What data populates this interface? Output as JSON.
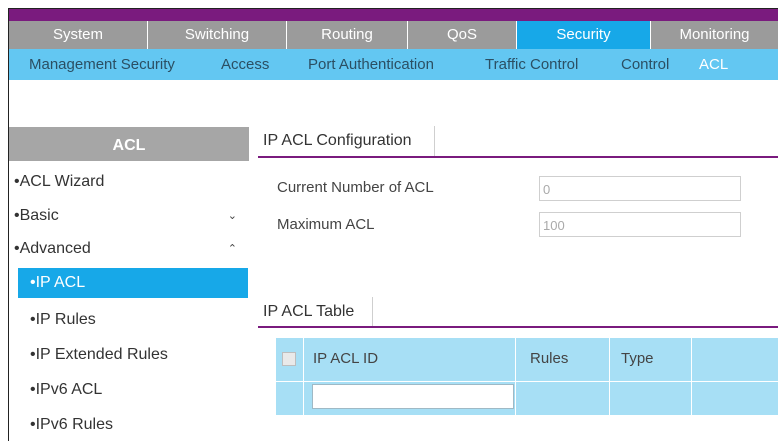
{
  "topnav": {
    "tabs": [
      {
        "label": "System"
      },
      {
        "label": "Switching"
      },
      {
        "label": "Routing"
      },
      {
        "label": "QoS"
      },
      {
        "label": "Security",
        "active": true
      },
      {
        "label": "Monitoring"
      }
    ]
  },
  "subnav": {
    "items": [
      {
        "label": "Management Security"
      },
      {
        "label": "Access"
      },
      {
        "label": "Port Authentication"
      },
      {
        "label": "Traffic Control"
      },
      {
        "label": "Control"
      },
      {
        "label": "ACL",
        "active": true
      }
    ]
  },
  "sidebar": {
    "header": "ACL",
    "items": [
      {
        "label": "ACL Wizard",
        "bullet": "•"
      },
      {
        "label": "Basic",
        "bullet": "•",
        "chevron": "⌄"
      },
      {
        "label": "Advanced",
        "bullet": "•",
        "chevron": "⌃"
      }
    ],
    "subitems": [
      {
        "label": "IP ACL",
        "bullet": "•",
        "active": true
      },
      {
        "label": "IP Rules",
        "bullet": "•"
      },
      {
        "label": "IP Extended Rules",
        "bullet": "•"
      },
      {
        "label": "IPv6 ACL",
        "bullet": "•"
      },
      {
        "label": "IPv6 Rules",
        "bullet": "•"
      }
    ]
  },
  "config": {
    "title": "IP ACL Configuration",
    "current_label": "Current Number of ACL",
    "current_value": "0",
    "max_label": "Maximum ACL",
    "max_value": "100"
  },
  "table": {
    "title": "IP ACL Table",
    "col_id": "IP ACL ID",
    "col_rules": "Rules",
    "col_type": "Type",
    "input_value": ""
  },
  "colors": {
    "brand_purple": "#7a1b7e",
    "tab_gray": "#9b9b9b",
    "accent_blue": "#17a8e8",
    "subnav_blue": "#63c7f2",
    "table_blue": "#a7dff5"
  }
}
